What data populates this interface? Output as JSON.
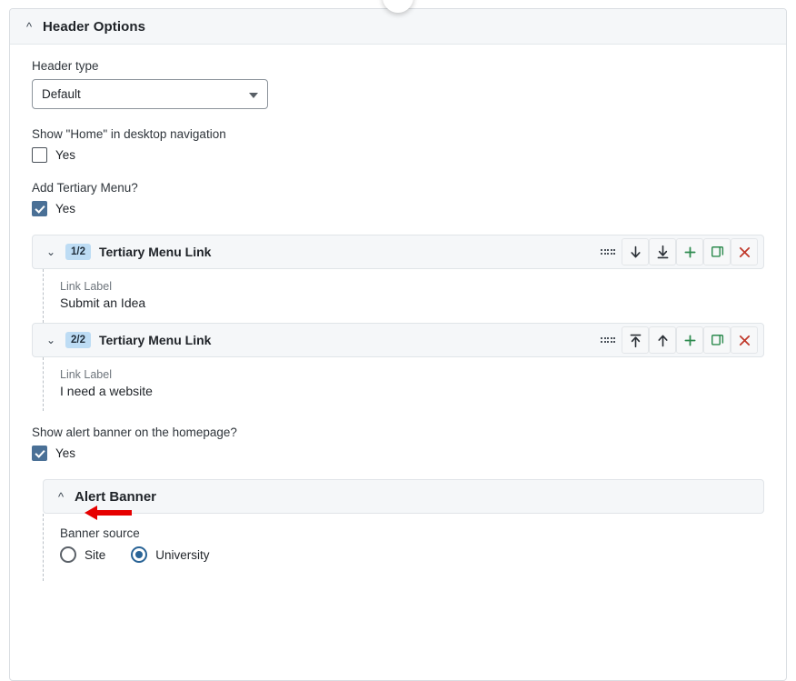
{
  "panel": {
    "title": "Header Options",
    "collapse_icon": "chevron-up-icon",
    "expanded": true
  },
  "fields": {
    "header_type": {
      "label": "Header type",
      "value": "Default",
      "options": [
        "Default"
      ],
      "caret_icon": "chevron-down-icon"
    },
    "show_home": {
      "label": "Show \"Home\" in desktop navigation",
      "checkbox_label": "Yes",
      "checked": false
    },
    "add_tertiary_menu": {
      "label": "Add Tertiary Menu?",
      "checkbox_label": "Yes",
      "checked": true
    },
    "show_alert_banner": {
      "label": "Show alert banner on the homepage?",
      "checkbox_label": "Yes",
      "checked": true
    }
  },
  "tertiary_menu_links": [
    {
      "badge": "1/2",
      "title": "Tertiary Menu Link",
      "collapse_icon": "chevron-down-icon",
      "sub_label": "Link Label",
      "sub_value": "Submit an Idea",
      "tools": [
        {
          "name": "drag-handle-icon",
          "glyph": "grip"
        },
        {
          "name": "move-down-icon",
          "glyph": "arrow-down"
        },
        {
          "name": "move-to-bottom-icon",
          "glyph": "arrow-down-to-line"
        },
        {
          "name": "add-item-icon",
          "glyph": "plus"
        },
        {
          "name": "duplicate-item-icon",
          "glyph": "copy"
        },
        {
          "name": "remove-item-icon",
          "glyph": "close"
        }
      ]
    },
    {
      "badge": "2/2",
      "title": "Tertiary Menu Link",
      "collapse_icon": "chevron-down-icon",
      "sub_label": "Link Label",
      "sub_value": "I need a website",
      "tools": [
        {
          "name": "drag-handle-icon",
          "glyph": "grip"
        },
        {
          "name": "move-to-top-icon",
          "glyph": "arrow-up-to-line"
        },
        {
          "name": "move-up-icon",
          "glyph": "arrow-up"
        },
        {
          "name": "add-item-icon",
          "glyph": "plus"
        },
        {
          "name": "duplicate-item-icon",
          "glyph": "copy"
        },
        {
          "name": "remove-item-icon",
          "glyph": "close"
        }
      ]
    }
  ],
  "alert_banner": {
    "title": "Alert Banner",
    "collapse_icon": "chevron-up-icon",
    "banner_source": {
      "label": "Banner source",
      "options": [
        {
          "label": "Site",
          "selected": false
        },
        {
          "label": "University",
          "selected": true
        }
      ]
    }
  },
  "colors": {
    "checkbox_checked": "#4a7096",
    "radio_selected": "#2a6496",
    "badge_bg": "#bddcf4",
    "panel_header_bg": "#f5f7f9",
    "add_green": "#2e8b4f",
    "remove_red": "#c0392b",
    "annotation_red": "#e60000"
  },
  "annotation": {
    "type": "arrow",
    "direction": "left",
    "color": "#e60000",
    "points_at": "show-alert-banner-checkbox"
  }
}
